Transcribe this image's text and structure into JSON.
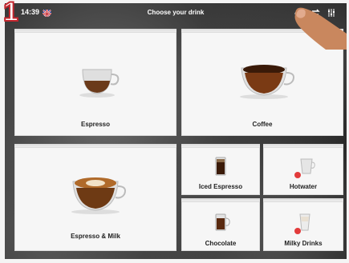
{
  "topbar": {
    "time": "14:39",
    "title": "Choose your drink",
    "icons": [
      "flag-uk-icon",
      "barista-icon",
      "switch-icon",
      "settings-icon"
    ]
  },
  "step_number": "1",
  "drinks": [
    {
      "label": "Espresso"
    },
    {
      "label": "Coffee"
    },
    {
      "label": "Espresso & Milk"
    },
    {
      "label": "Iced Espresso"
    },
    {
      "label": "Hotwater"
    },
    {
      "label": "Chocolate"
    },
    {
      "label": "Milky Drinks"
    }
  ],
  "colors": {
    "accent": "#c4262e",
    "badge": "#e23b3b",
    "tile": "#f6f6f6"
  }
}
